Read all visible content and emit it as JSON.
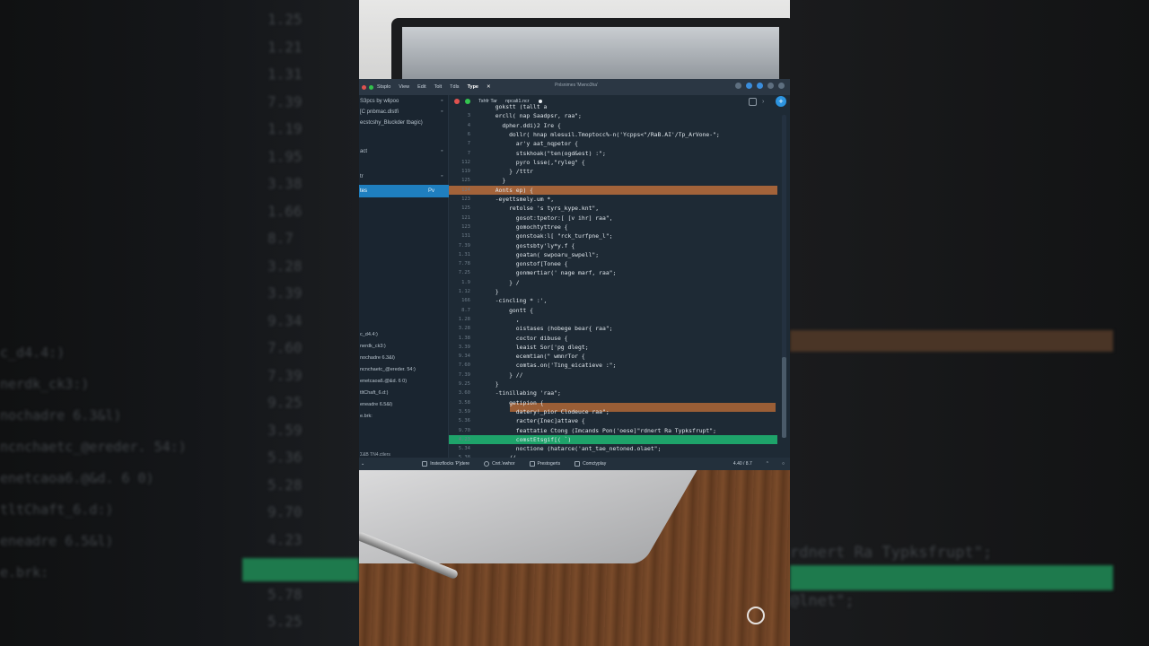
{
  "background_left": {
    "numbers": [
      "1.25",
      "1.21",
      "1.31",
      "7.39",
      "1.19",
      "1.95",
      "3.38",
      "1.66",
      "8.7",
      "3.28",
      "3.39",
      "9.34",
      "7.60",
      "7.39",
      "9.25",
      "3.59",
      "5.36",
      "5.28",
      "9.70",
      "4.23",
      "5.34",
      "5.78",
      "5.25"
    ],
    "files": [
      "c_d4.4:)",
      "nerdk_ck3:)",
      "nochadre 6.3&l)",
      "ncnchaetc_@ereder. 54:)",
      "enetcaoa6.@&d. 6 0)",
      "tltChaft_6.d:)",
      "eneadre 6.5&l)",
      "e.brk:"
    ]
  },
  "background_right": {
    "lines": [
      "rdnert Ra Typksfrupt\";",
      "@lnet\";"
    ]
  },
  "menubar": {
    "app": "Stsplo",
    "items": [
      "View",
      "Edit",
      "Tolt",
      "Tdls",
      "Type"
    ],
    "center_title": "Pnlsnimes 'Mwno3ha'"
  },
  "sidebar": {
    "items": [
      {
        "label": "S3pcs by wlipoo",
        "pin": "⁍"
      },
      {
        "label": "[C pnbmac.dlstfi",
        "pin": "⁍"
      },
      {
        "label": "ecstcshy_Bluckder tbagic)",
        "pin": ""
      },
      {
        "label": "act",
        "pin": "⁍"
      },
      {
        "label": "tr",
        "pin": "⁍"
      },
      {
        "label": "tes",
        "pin": "Pv"
      }
    ],
    "files": [
      "c_d4.4:)",
      "nerdk_ck3:)",
      "nochadre 6.3&l)",
      "ncnchaetc_@ereder. 54:)",
      "enetcaoa6.@&d. 6 0)",
      "tltChaft_6.d:)",
      "eneadre 6.5&l)",
      "e.brk:"
    ],
    "footer": "Σ&B TN4.ctlers"
  },
  "tabbar": {
    "tabs": [
      "Tshfr Tar",
      "npcali1.ncr"
    ]
  },
  "code": {
    "lines": [
      {
        "ln": "",
        "text": "  gokstt (tallt a"
      },
      {
        "ln": "3",
        "text": "  ercll( nap Saadpsr, raa\";"
      },
      {
        "ln": "4",
        "text": "    dpher.ddi)2 Ire {"
      },
      {
        "ln": "6",
        "text": "      dollr( hnap mlesuil.Tmoptocc%-n('Ycpps<\"/RaB.AI'/Tp_ArVone-\";"
      },
      {
        "ln": "7",
        "text": "        ar'y aat_nqpetor {"
      },
      {
        "ln": "7",
        "text": "        stskhoak(\"ten(ogd&est) :\";"
      },
      {
        "ln": "112",
        "text": "        pyro lsse(,\"ryleg\" {"
      },
      {
        "ln": "119",
        "text": "      } /tttr"
      },
      {
        "ln": "125",
        "text": "    }"
      },
      {
        "ln": "124",
        "text": "  Aonts ep) {"
      },
      {
        "ln": "123",
        "text": "  -eyettsmely.um *,"
      },
      {
        "ln": "125",
        "text": "      retolse 's tyrs_kype.knt\","
      },
      {
        "ln": "121",
        "text": "        gosot:tpetor:[ [v ihr] raa\","
      },
      {
        "ln": "123",
        "text": "        gomochtyttree {"
      },
      {
        "ln": "131",
        "text": "        gonstoak:l[ \"rck_turfpne_l\";"
      },
      {
        "ln": "7.39",
        "text": "        gostsbty'ly*y.f {"
      },
      {
        "ln": "1.31",
        "text": "        goatan( swpoaru_swpell\";"
      },
      {
        "ln": "7.78",
        "text": "        gonstof[Tonee {"
      },
      {
        "ln": "7.25",
        "text": "        gonmertiar(' nage marf, raa\";"
      },
      {
        "ln": "1.9",
        "text": "      } /"
      },
      {
        "ln": "1.12",
        "text": "  }"
      },
      {
        "ln": "166",
        "text": "  -cincling * :',"
      },
      {
        "ln": "8.7",
        "text": "      gontt {"
      },
      {
        "ln": "1.28",
        "text": "        ,"
      },
      {
        "ln": "3.28",
        "text": "        oistases (hobege bear{ raa\";"
      },
      {
        "ln": "1.38",
        "text": "        coctor dibuse {"
      },
      {
        "ln": "3.39",
        "text": "        leaist Sor['pg dlegt;"
      },
      {
        "ln": "9.34",
        "text": "        ecemtian(\" wmnrTor {"
      },
      {
        "ln": "7.60",
        "text": "        comtas.on('Ting_eicatieve :\";"
      },
      {
        "ln": "7.39",
        "text": "      } //"
      },
      {
        "ln": "9.25",
        "text": "  }"
      },
      {
        "ln": "3.60",
        "text": "  -tinillabing 'raa\";"
      },
      {
        "ln": "3.58",
        "text": "      getipion {"
      },
      {
        "ln": "3.59",
        "text": "        datery!_pior Clodeuce raa\";"
      },
      {
        "ln": "5.36",
        "text": "        racter{Inec]attave {"
      },
      {
        "ln": "9.70",
        "text": "        feattatie Ctong (Imcands Pon('oese]\"rdnert Ra Typksfrupt\";"
      },
      {
        "ln": "4.23",
        "text": "        comstEtsgif[( `)"
      },
      {
        "ln": "5.34",
        "text": "        noctione (hatarce('ant_tae_netoned.olaet\";"
      },
      {
        "ln": "5.38",
        "text": "      //"
      },
      {
        "ln": "5.25",
        "text": "    }"
      },
      {
        "ln": "5.19",
        "text": "  }"
      }
    ]
  },
  "statusbar": {
    "items": [
      "Instezflocks 'P'jdere",
      "Cnrt.'ewhor",
      "Prestogerts",
      "Comctyplay"
    ],
    "position": "4.40 / 8.7 "
  },
  "colors": {
    "editor_bg": "#1e2a35",
    "highlight_orange": "#a3633a",
    "highlight_green": "#1ea36a",
    "accent_blue": "#1f7fbf"
  }
}
